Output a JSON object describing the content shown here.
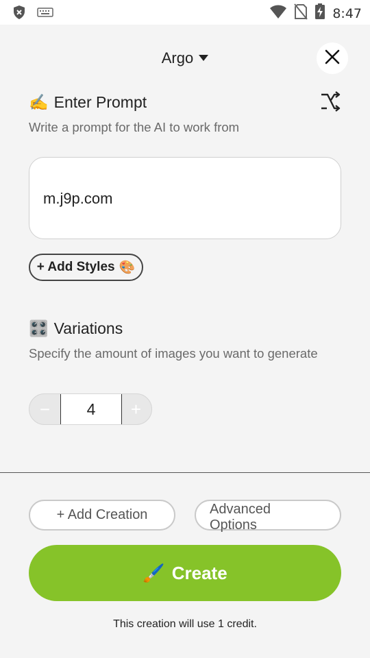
{
  "statusbar": {
    "time": "8:47",
    "icons": [
      "shield-icon",
      "keyboard-icon",
      "wifi-icon",
      "no-sim-icon",
      "battery-charging-icon"
    ]
  },
  "header": {
    "title": "Argo",
    "icons": [
      "chevron-down-icon",
      "close-icon"
    ]
  },
  "prompt": {
    "title": "Enter Prompt",
    "emoji": "✍️",
    "subtitle": "Write a prompt for the AI to work from",
    "value": "m.j9p.com",
    "shuffle_icon": "shuffle-icon"
  },
  "styles": {
    "label": "+ Add Styles",
    "emoji": "🎨"
  },
  "variations": {
    "title": "Variations",
    "emoji": "🎛️",
    "subtitle": "Specify the amount of images you want to generate",
    "value": "4",
    "minus": "−",
    "plus": "+"
  },
  "actions": {
    "add_creation": "+ Add Creation",
    "advanced_line1": "Advanced",
    "advanced_line2": "Options",
    "create_label": "Create",
    "create_emoji": "🖌️",
    "credit_note": "This creation will use 1 credit."
  },
  "colors": {
    "accent": "#86c329",
    "background": "#f4f4f4",
    "stepper_button": "#e8e8e8"
  }
}
